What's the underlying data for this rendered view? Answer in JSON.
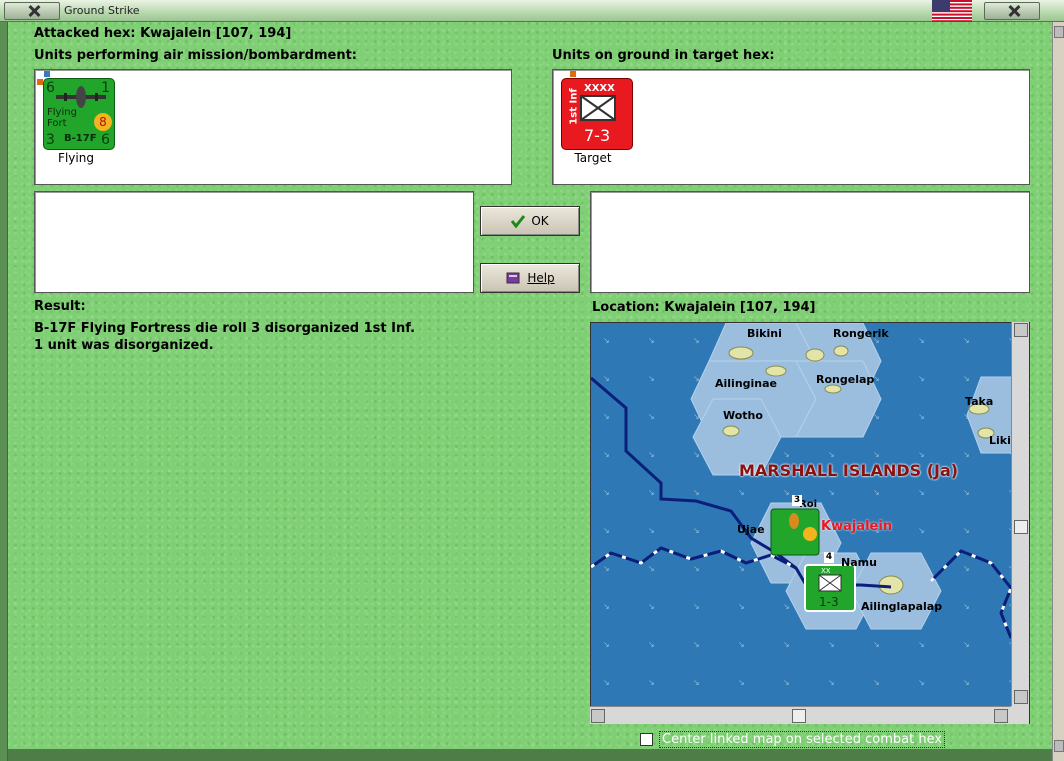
{
  "window": {
    "title": "Ground Strike",
    "flag": "us-flag-icon"
  },
  "attacked_hex": "Attacked hex: Kwajalein  [107, 194]",
  "air_units": {
    "heading": "Units performing air mission/bombardment:",
    "unit": {
      "top_left": "6",
      "top_right": "1",
      "name_line1": "Flying",
      "name_line2": "Fort",
      "rating": "8",
      "model": "B-17F",
      "bottom_left": "3",
      "bottom_right": "6",
      "caption": "Flying"
    }
  },
  "ground_units": {
    "heading": "Units on ground in target hex:",
    "unit": {
      "side_label": "1st Inf",
      "size": "XXXX",
      "strength": "7-3",
      "caption": "Target"
    }
  },
  "buttons": {
    "ok": "OK",
    "help": "Help"
  },
  "result": {
    "heading": "Result:",
    "line1": "B-17F Flying Fortress die roll 3 disorganized 1st Inf.",
    "line2": "1 unit was disorganized."
  },
  "location": {
    "heading": "Location:  Kwajalein  [107, 194]",
    "map_labels": {
      "bikini": "Bikini",
      "rongerik": "Rongerik",
      "ailinginae": "Ailinginae",
      "rongelap": "Rongelap",
      "wotho": "Wotho",
      "taka": "Taka",
      "liki": "Liki",
      "region": "MARSHALL ISLANDS (Ja)",
      "ujae": "Ujae",
      "kwajalein": "Kwajalein",
      "namu": "Namu",
      "ailinglapalap": "Ailinglapalap",
      "roi": "Roi",
      "stack_count_1": "3",
      "stack_count_2": "4",
      "map_unit_strength": "1-3",
      "map_unit_size": "XX"
    }
  },
  "checkbox": {
    "label": "Center linked map on selected combat hex",
    "checked": false
  },
  "colors": {
    "felt": "#7fcf74",
    "ocean": "#2d78b5",
    "unit_green": "#22a52b",
    "unit_red": "#e8191f",
    "region_label": "#8b1010"
  }
}
